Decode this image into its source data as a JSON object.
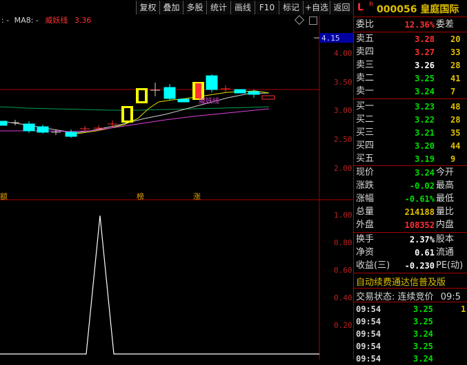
{
  "toolbar": {
    "buttons": [
      "复权",
      "叠加",
      "多股",
      "统计",
      "画线",
      "F10",
      "标记",
      "+自选",
      "返回"
    ]
  },
  "indicator": {
    "prefix": ": -",
    "ma8_label": "MA8: -",
    "name": "威妖线",
    "value": "3.36"
  },
  "price_axis": {
    "current_tag": "4.15",
    "ticks": [
      "4.00",
      "3.50",
      "3.00",
      "2.50",
      "2.00"
    ]
  },
  "markers": [
    "额",
    "榜",
    "涨"
  ],
  "chart_annotation": "威妖线",
  "lower_axis": {
    "ticks": [
      "1.00",
      "0.80",
      "0.60",
      "0.40",
      "0.20"
    ]
  },
  "stock": {
    "badge_l": "L",
    "badge_r": "R",
    "code": "000056",
    "name": "皇庭国际"
  },
  "weibi": {
    "label": "委比",
    "value": "12.36%",
    "label2": "委差"
  },
  "asks": [
    {
      "label": "卖五",
      "price": "3.28",
      "vol": "20"
    },
    {
      "label": "卖四",
      "price": "3.27",
      "vol": "33"
    },
    {
      "label": "卖三",
      "price": "3.26",
      "vol": "28"
    },
    {
      "label": "卖二",
      "price": "3.25",
      "vol": "41"
    },
    {
      "label": "卖一",
      "price": "3.24",
      "vol": "7"
    }
  ],
  "bids": [
    {
      "label": "买一",
      "price": "3.23",
      "vol": "48"
    },
    {
      "label": "买二",
      "price": "3.22",
      "vol": "28"
    },
    {
      "label": "买三",
      "price": "3.21",
      "vol": "35"
    },
    {
      "label": "买四",
      "price": "3.20",
      "vol": "44"
    },
    {
      "label": "买五",
      "price": "3.19",
      "vol": "9"
    }
  ],
  "quote": [
    {
      "label": "现价",
      "value": "3.24",
      "label2": "今开"
    },
    {
      "label": "涨跌",
      "value": "-0.02",
      "label2": "最高"
    },
    {
      "label": "涨幅",
      "value": "-0.61%",
      "label2": "最低"
    },
    {
      "label": "总量",
      "value": "214188",
      "label2": "量比"
    },
    {
      "label": "外盘",
      "value": "108352",
      "label2": "内盘"
    }
  ],
  "stats": [
    {
      "label": "换手",
      "value": "2.37%",
      "label2": "股本"
    },
    {
      "label": "净资",
      "value": "0.61",
      "label2": "流通"
    },
    {
      "label": "收益(三)",
      "value": "-0.230",
      "label2": "PE(动)"
    }
  ],
  "promo": "自动续费通达信普及版",
  "trade_state": {
    "label": "交易状态:",
    "value": "连续竞价",
    "time": "09:5"
  },
  "ticks": [
    {
      "time": "09:54",
      "price": "3.25",
      "vol": "1"
    },
    {
      "time": "09:54",
      "price": "3.25",
      "vol": ""
    },
    {
      "time": "09:54",
      "price": "3.24",
      "vol": ""
    },
    {
      "time": "09:54",
      "price": "3.25",
      "vol": ""
    },
    {
      "time": "09:54",
      "price": "3.24",
      "vol": ""
    }
  ],
  "colors": {
    "up": "#ff3030",
    "down": "#00e000",
    "accent_border": "#aa0000",
    "candle_up": "#ffff00",
    "candle_down": "#00ffff"
  }
}
